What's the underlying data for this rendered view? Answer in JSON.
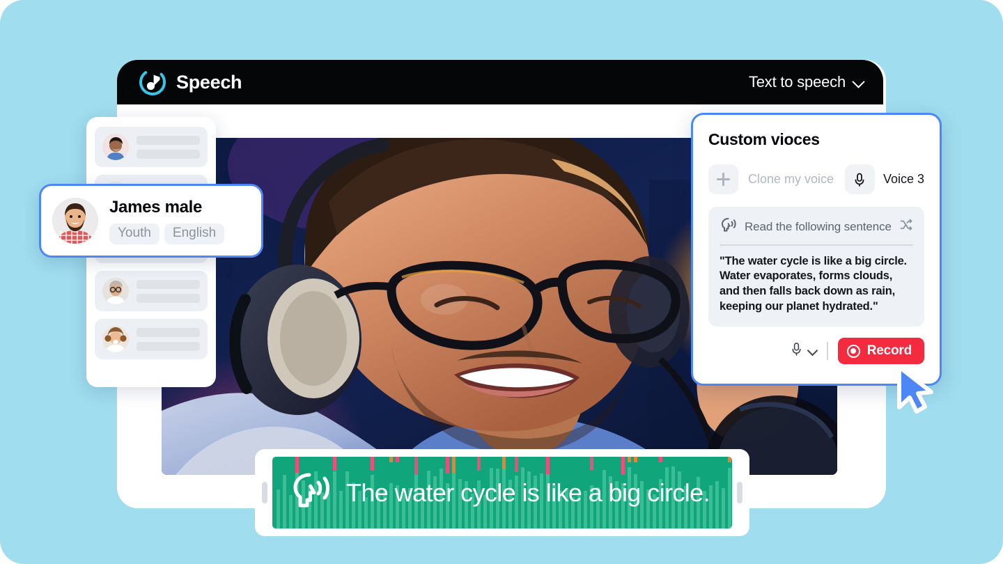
{
  "theme": {
    "background": "#9fddef",
    "card_background": "#ffffff",
    "header_background": "#050608",
    "accent_blue": "#4d86f7",
    "record_red": "#f42a3e",
    "caption_green": "#11a57b",
    "caption_wave": "#3bbd96",
    "wave_accent_orange": "#f08030",
    "wave_accent_pink": "#ef4e7b",
    "logo_cyan": "#35c6e8"
  },
  "header": {
    "brand_name": "Speech",
    "logo_icon": "speech-note-logo-icon",
    "mode_label": "Text to speech",
    "mode_chevron_icon": "chevron-down-icon"
  },
  "hero": {
    "alt": "man-with-headphones-at-microphone-photo"
  },
  "voice_list": {
    "rows": [
      {
        "avatar": "boy-avatar",
        "placeholder": true
      },
      {
        "avatar": "man-avatar",
        "placeholder": true
      },
      {
        "avatar": "woman-avatar",
        "placeholder": true
      },
      {
        "avatar": "older-man-avatar",
        "placeholder": true
      },
      {
        "avatar": "girl-avatar",
        "placeholder": true
      }
    ]
  },
  "selected_voice": {
    "avatar": "james-avatar",
    "name": "James male",
    "tags": [
      "Youth",
      "English"
    ]
  },
  "custom_voices": {
    "title": "Custom vioces",
    "clone": {
      "icon": "plus-icon",
      "label": "Clone my voice"
    },
    "voice_slot": {
      "icon": "microphone-icon",
      "label": "Voice 3"
    },
    "sentence_box": {
      "head_icon": "speaking-head-icon",
      "head_label": "Read the following sentence",
      "shuffle_icon": "shuffle-icon",
      "text": "\"The water cycle is like a big circle. Water evaporates, forms clouds, and then falls back down as rain, keeping our planet hydrated.\""
    },
    "record_bar": {
      "mic_icon": "microphone-icon",
      "mic_chevron_icon": "chevron-down-icon",
      "record_icon": "record-dot-icon",
      "record_label": "Record"
    }
  },
  "cursor": {
    "icon": "mouse-pointer-icon"
  },
  "caption": {
    "icon": "speaking-head-icon",
    "text": "The water cycle is like a big circle.",
    "handle_left_icon": "resize-handle-icon",
    "handle_right_icon": "resize-handle-icon"
  }
}
